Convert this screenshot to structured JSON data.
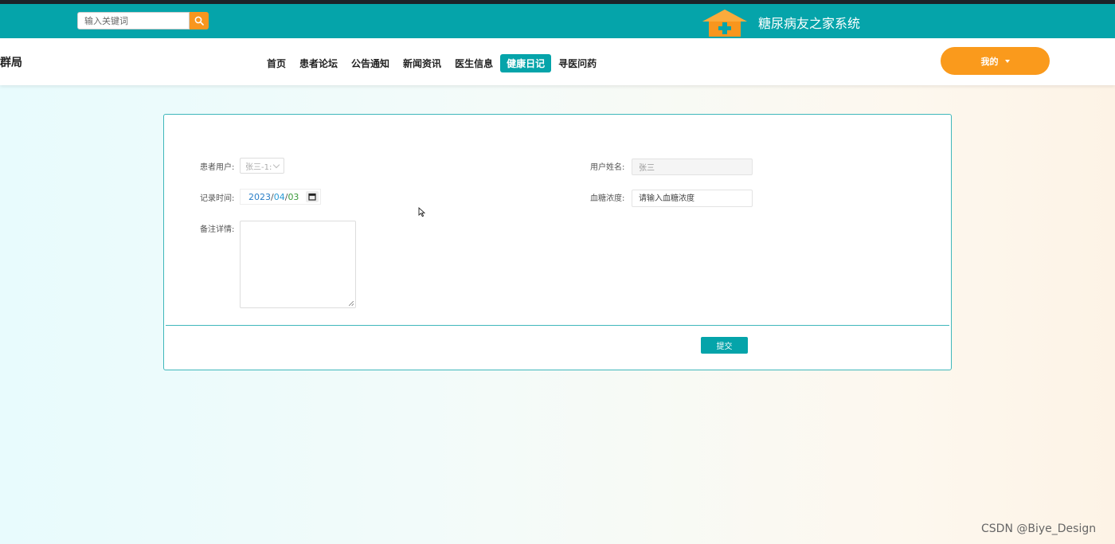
{
  "header": {
    "search_placeholder": "输入关键词",
    "site_title": "糖尿病友之家系统",
    "brand_fragment": "糖群局"
  },
  "nav": {
    "items": [
      {
        "label": "首页"
      },
      {
        "label": "患者论坛"
      },
      {
        "label": "公告通知"
      },
      {
        "label": "新闻资讯"
      },
      {
        "label": "医生信息"
      },
      {
        "label": "健康日记",
        "active": true
      },
      {
        "label": "寻医问药"
      }
    ],
    "my_button": "我的"
  },
  "form": {
    "patient_label": "患者用户:",
    "patient_value": "张三-1:",
    "username_label": "用户姓名:",
    "username_value": "张三",
    "record_time_label": "记录时间:",
    "date_year": "2023",
    "date_month": "04",
    "date_day": "03",
    "date_sep": "/",
    "blood_sugar_label": "血糖浓度:",
    "blood_sugar_placeholder": "请输入血糖浓度",
    "remarks_label": "备注详情:",
    "submit_label": "提交"
  },
  "watermark": "CSDN @Biye_Design",
  "colors": {
    "primary": "#05a4aa",
    "accent": "#fa9a1c",
    "top_strip": "#1c2329"
  }
}
